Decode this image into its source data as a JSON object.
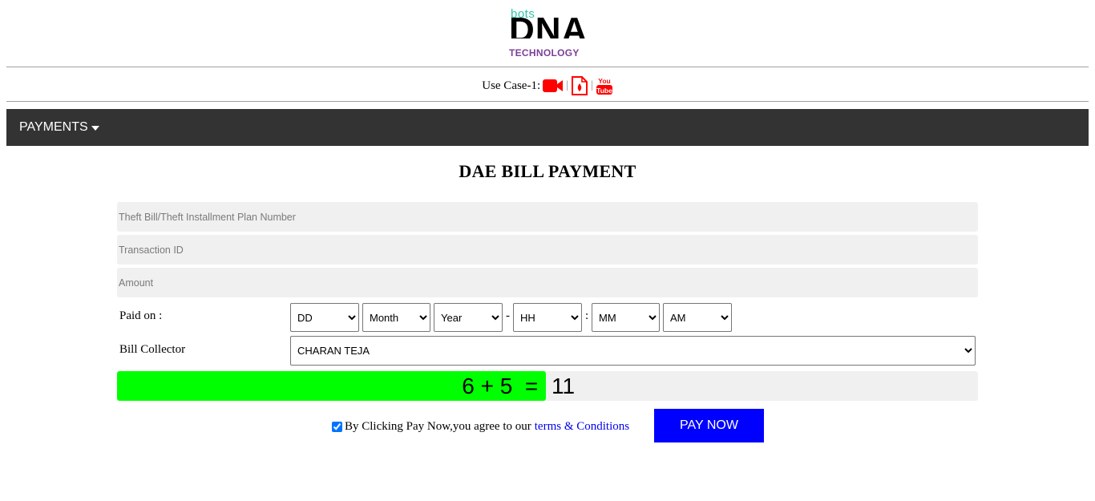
{
  "logo": {
    "bots": "bots",
    "dna": "DNA",
    "technology": "TECHNOLOGY"
  },
  "use_case": {
    "label": "Use Case-1:",
    "separator": "|",
    "icons": [
      "video-icon",
      "pdf-file-icon",
      "youtube-icon"
    ],
    "icon_color": "#ff0000"
  },
  "nav": {
    "menu_label": "PAYMENTS",
    "background": "#333333"
  },
  "form": {
    "title": "DAE BILL PAYMENT",
    "bill_number_placeholder": "Theft Bill/Theft Installment Plan Number",
    "transaction_id_placeholder": "Transaction ID",
    "amount_placeholder": "Amount",
    "paid_on_label": "Paid on :",
    "paid_on": {
      "day": "DD",
      "month": "Month",
      "year": "Year",
      "hour": "HH",
      "minute": "MM",
      "ampm": "AM",
      "date_time_separator": "-",
      "time_separator": ":"
    },
    "bill_collector_label": "Bill Collector",
    "bill_collector_value": "CHARAN TEJA",
    "captcha_question": "6 + 5  = ",
    "captcha_answer": "11",
    "captcha_color": "#00ff00",
    "agree_checked": true,
    "agree_text": "By Clicking Pay Now,you agree to our",
    "terms_link": "terms & Conditions",
    "pay_button": "PAY NOW",
    "pay_button_color": "#0000ff"
  }
}
